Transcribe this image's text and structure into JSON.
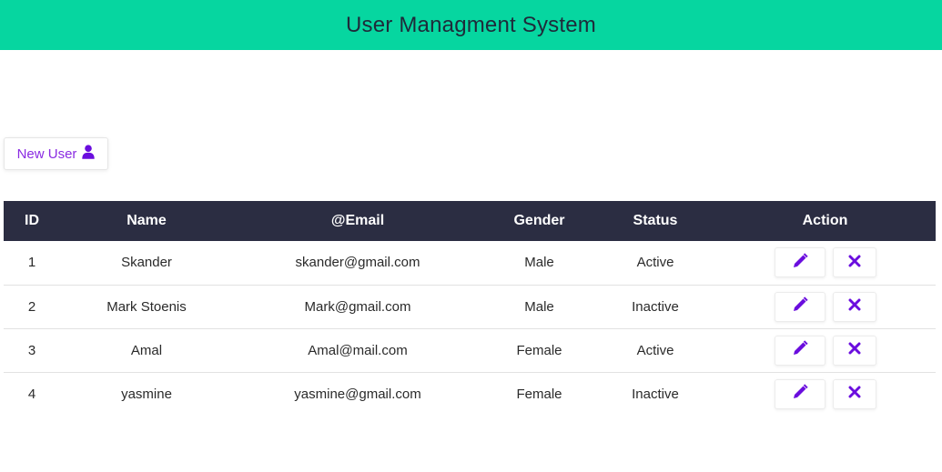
{
  "header": {
    "title": "User Managment System",
    "bg_color": "#06d6a0"
  },
  "toolbar": {
    "new_user_label": "New User",
    "new_user_icon": "user-icon",
    "accent_color": "#8a2be2"
  },
  "table": {
    "columns": [
      "ID",
      "Name",
      "@Email",
      "Gender",
      "Status",
      "Action"
    ],
    "rows": [
      {
        "id": "1",
        "name": "Skander",
        "email": "skander@gmail.com",
        "gender": "Male",
        "status": "Active"
      },
      {
        "id": "2",
        "name": "Mark Stoenis",
        "email": "Mark@gmail.com",
        "gender": "Male",
        "status": "Inactive"
      },
      {
        "id": "3",
        "name": "Amal",
        "email": "Amal@mail.com",
        "gender": "Female",
        "status": "Active"
      },
      {
        "id": "4",
        "name": "yasmine",
        "email": "yasmine@gmail.com",
        "gender": "Female",
        "status": "Inactive"
      }
    ],
    "row_actions": [
      "pencil-icon",
      "close-icon"
    ],
    "header_bg": "#2b2d42"
  }
}
